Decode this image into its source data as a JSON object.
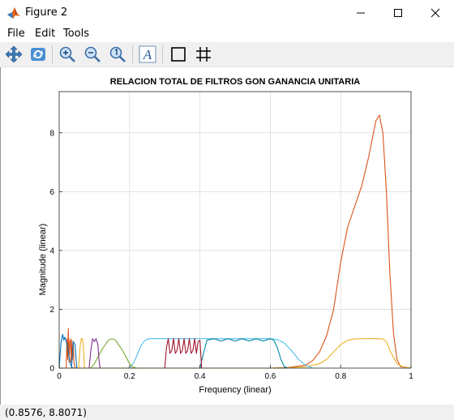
{
  "window": {
    "title": "Figure 2",
    "minimize_icon": "minimize-icon",
    "maximize_icon": "maximize-icon",
    "close_icon": "close-icon"
  },
  "menu": {
    "file": "File",
    "edit": "Edit",
    "tools": "Tools"
  },
  "toolbar": {
    "icons": [
      "pan-icon",
      "rotate-icon",
      "zoom-in-icon",
      "zoom-out-icon",
      "zoom-reset-icon",
      "text-insert-icon",
      "box-icon",
      "grid-icon"
    ]
  },
  "status": {
    "coords": "(0.8576, 8.8071)"
  },
  "chart_data": {
    "type": "line",
    "title": "RELACION TOTAL DE FILTROS GON GANANCIA UNITARIA",
    "xlabel": "Frequency (linear)",
    "ylabel": "Magnitude (linear)",
    "xlim": [
      0,
      1
    ],
    "ylim": [
      0,
      9.4
    ],
    "xticks": [
      "0",
      "0.2",
      "0.4",
      "0.6",
      "0.8",
      "1"
    ],
    "yticks": [
      "0",
      "2",
      "4",
      "6",
      "8"
    ],
    "grid": true,
    "colors": {
      "blue": "#0072bd",
      "orange": "#d95319",
      "yellow": "#edb120",
      "purple": "#7e2f8e",
      "green": "#77ac30",
      "cyan": "#4dbeee",
      "red": "#a2142f",
      "teal": "#0085a0"
    },
    "series": [
      {
        "color": "orange",
        "x": [
          0,
          0.02,
          0.04,
          0.06,
          0.2,
          0.4,
          0.6,
          0.65,
          0.7,
          0.72,
          0.74,
          0.76,
          0.78,
          0.8,
          0.82,
          0.84,
          0.86,
          0.88,
          0.9,
          0.91,
          0.92,
          0.93,
          0.94,
          0.95,
          0.96,
          0.97,
          1
        ],
        "y": [
          0,
          0,
          0,
          0,
          0,
          0,
          0,
          0.02,
          0.1,
          0.25,
          0.55,
          1.1,
          2.0,
          3.6,
          4.8,
          5.5,
          6.2,
          7.2,
          8.4,
          8.6,
          8.0,
          6.0,
          3.2,
          1.2,
          0.3,
          0.05,
          0
        ]
      },
      {
        "color": "yellow",
        "x": [
          0,
          0.6,
          0.65,
          0.7,
          0.74,
          0.76,
          0.78,
          0.8,
          0.82,
          0.84,
          0.86,
          0.88,
          0.9,
          0.91,
          0.92,
          0.93,
          0.94,
          0.96,
          0.98,
          1
        ],
        "y": [
          0,
          0,
          0.01,
          0.05,
          0.15,
          0.3,
          0.55,
          0.8,
          0.95,
          0.99,
          1.0,
          1.0,
          1.0,
          1.0,
          0.99,
          0.9,
          0.6,
          0.15,
          0.02,
          0
        ]
      },
      {
        "color": "cyan",
        "x": [
          0.2,
          0.21,
          0.22,
          0.23,
          0.24,
          0.25,
          0.26,
          0.4,
          0.6,
          0.62,
          0.64,
          0.66,
          0.68,
          0.7,
          0.72
        ],
        "y": [
          0,
          0.15,
          0.4,
          0.7,
          0.9,
          0.98,
          1.0,
          1.0,
          1.0,
          0.97,
          0.85,
          0.6,
          0.3,
          0.1,
          0
        ]
      },
      {
        "color": "teal",
        "x": [
          0.4,
          0.41,
          0.42,
          0.44,
          0.46,
          0.48,
          0.5,
          0.52,
          0.54,
          0.56,
          0.58,
          0.6,
          0.61,
          0.62,
          0.63,
          0.64,
          0.65
        ],
        "y": [
          0,
          0.5,
          0.95,
          1.0,
          0.92,
          1.0,
          0.92,
          1.0,
          0.92,
          1.0,
          0.92,
          1.0,
          0.95,
          0.7,
          0.3,
          0.05,
          0
        ]
      },
      {
        "color": "red",
        "x": [
          0.3,
          0.305,
          0.31,
          0.315,
          0.32,
          0.325,
          0.33,
          0.335,
          0.34,
          0.345,
          0.35,
          0.355,
          0.36,
          0.365,
          0.37,
          0.375,
          0.38,
          0.385,
          0.39,
          0.395,
          0.4,
          0.405
        ],
        "y": [
          0,
          0.7,
          1.0,
          0.5,
          0.6,
          1.0,
          0.5,
          0.6,
          1.0,
          0.5,
          0.6,
          1.0,
          0.5,
          0.6,
          1.0,
          0.5,
          0.6,
          1.0,
          0.5,
          0.9,
          0.95,
          0
        ]
      },
      {
        "color": "green",
        "x": [
          0.09,
          0.1,
          0.12,
          0.14,
          0.15,
          0.16,
          0.18,
          0.2,
          0.21,
          0.22
        ],
        "y": [
          0,
          0.15,
          0.6,
          0.95,
          1.0,
          0.95,
          0.6,
          0.15,
          0.03,
          0
        ]
      },
      {
        "color": "purple",
        "x": [
          0.085,
          0.09,
          0.095,
          0.1,
          0.105,
          0.11,
          0.113,
          0.116
        ],
        "y": [
          0,
          0.6,
          1.0,
          0.9,
          1.0,
          0.8,
          0.3,
          0
        ]
      },
      {
        "color": "yellow",
        "x": [
          0.055,
          0.06,
          0.063,
          0.066,
          0.069,
          0.072
        ],
        "y": [
          0,
          0.8,
          1.0,
          1.0,
          0.7,
          0
        ]
      },
      {
        "color": "orange",
        "x": [
          0.02,
          0.022,
          0.024,
          0.026,
          0.028,
          0.03,
          0.032,
          0.034,
          0.036,
          0.038,
          0.04,
          0.042,
          0.045
        ],
        "y": [
          0,
          1.0,
          0.3,
          1.35,
          0.2,
          0.9,
          1.0,
          0.2,
          0.95,
          0.3,
          0.8,
          0.2,
          0
        ]
      },
      {
        "color": "blue",
        "x": [
          0,
          0.005,
          0.01,
          0.013,
          0.016,
          0.02,
          0.024,
          0.028,
          0.032,
          0.036,
          0.04
        ],
        "y": [
          0,
          0.85,
          1.15,
          0.95,
          1.05,
          0.9,
          0.7,
          0.4,
          0.15,
          0.03,
          0
        ]
      },
      {
        "color": "blue",
        "x": [
          0.035,
          0.04,
          0.045,
          0.05
        ],
        "y": [
          0,
          0.9,
          0.8,
          0
        ]
      }
    ]
  }
}
